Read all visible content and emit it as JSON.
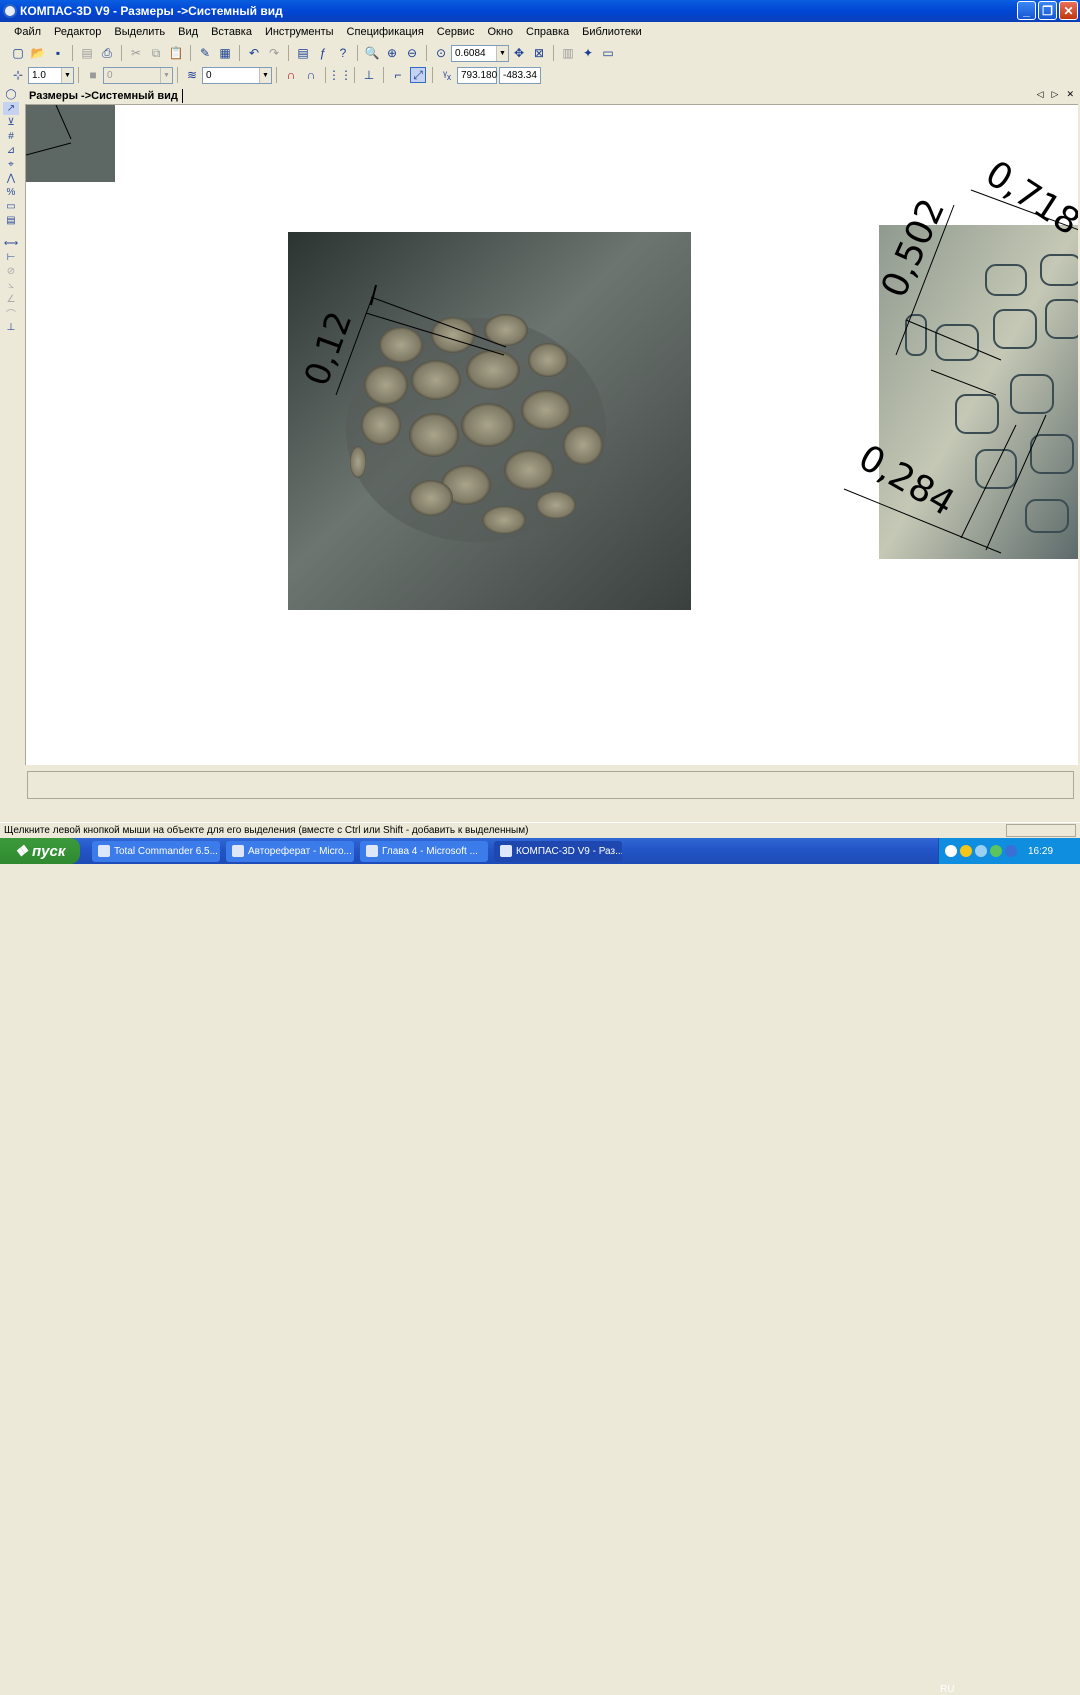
{
  "window": {
    "title": "КОМПАС-3D V9 - Размеры ->Системный вид"
  },
  "menu": [
    "Файл",
    "Редактор",
    "Выделить",
    "Вид",
    "Вставка",
    "Инструменты",
    "Спецификация",
    "Сервис",
    "Окно",
    "Справка",
    "Библиотеки"
  ],
  "toolbar": {
    "zoom": "0.6084",
    "step": "1.0",
    "layer_disabled": "0",
    "layer": "0",
    "coord_x": "793.180",
    "coord_y": "-483.34"
  },
  "document": {
    "tab": "Размеры ->Системный вид"
  },
  "dimensions": {
    "center": "0,12",
    "right_top_1": "0,502",
    "right_top_2": "0,718",
    "right_bottom": "0,284"
  },
  "status": {
    "message": "Щелкните левой кнопкой мыши на объекте для его выделения (вместе с Ctrl или Shift - добавить к выделенным)"
  },
  "taskbar": {
    "start": "пуск",
    "tasks": [
      "Total Commander 6.5...",
      "Автореферат - Micro...",
      "Глава 4 - Microsoft ...",
      "КОМПАС-3D V9 - Раз..."
    ],
    "lang": "RU",
    "time": "16:29"
  }
}
